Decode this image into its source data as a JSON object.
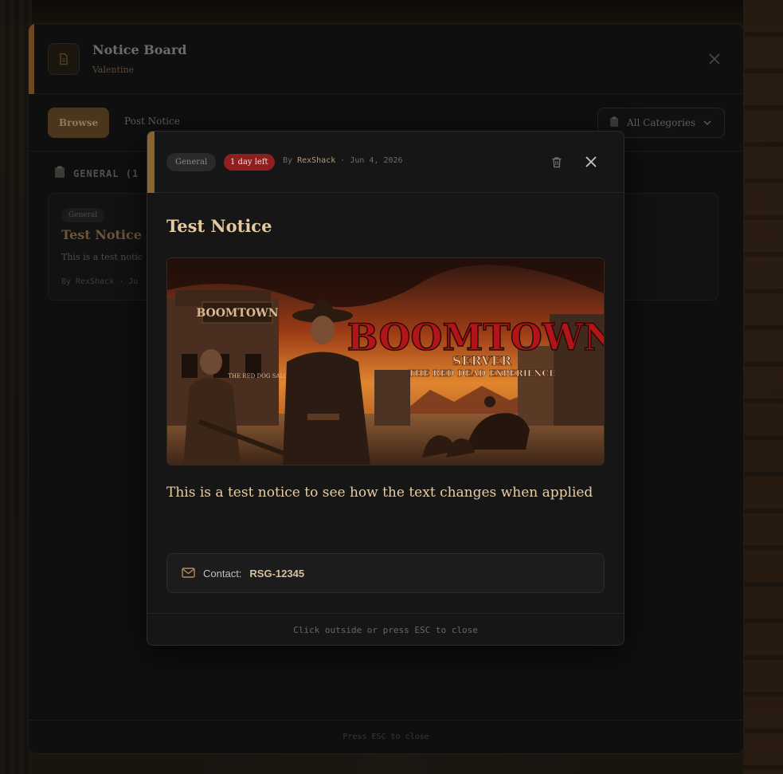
{
  "board": {
    "title": "Notice Board",
    "location": "Valentine",
    "tabs": {
      "browse": "Browse",
      "post": "Post Notice"
    },
    "category_filter": "All Categories",
    "section_title": "GENERAL (1",
    "footer": "Press ESC to close"
  },
  "card": {
    "tag": "General",
    "title": "Test Notice",
    "body": "This is a test notic",
    "meta": "By RexShack · Ju"
  },
  "modal": {
    "tag": "General",
    "urgency": "1 day left",
    "by_label": "By",
    "author": "RexShack",
    "date": "· Jun 4, 2026",
    "title": "Test Notice",
    "image_heading": "BOOMTOWN",
    "image_subheading": "SERVER",
    "image_tagline": "THE RED DEAD EXPERIENCE",
    "image_sign": "BOOMTOWN",
    "image_sign2": "THE RED DOG SALOON",
    "body": "This is a test notice to see how the text changes when applied",
    "contact_label": "Contact:",
    "contact_value": "RSG-12345",
    "footer": "Click outside or press ESC to close"
  },
  "colors": {
    "accent": "#8a642f",
    "urgent": "#8f1f1f",
    "title": "#e2c99e"
  },
  "icons": [
    "document-icon",
    "close-icon",
    "clipboard-icon",
    "trash-icon",
    "mail-icon",
    "chevron-down-icon"
  ]
}
